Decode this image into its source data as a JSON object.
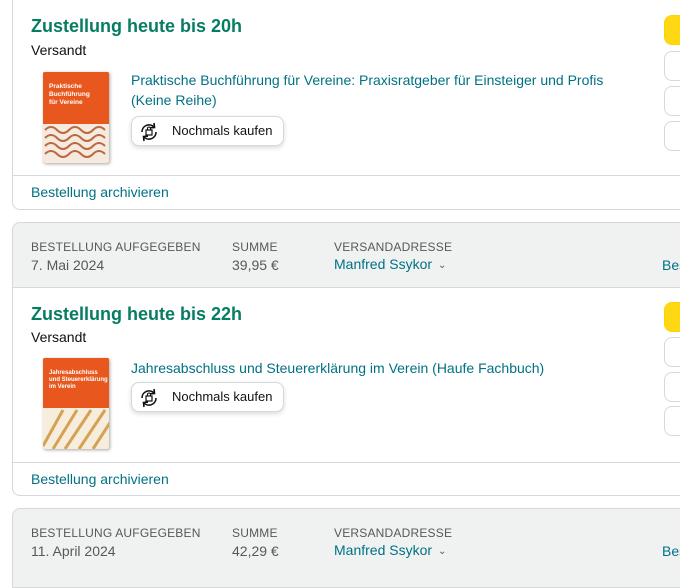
{
  "orders": [
    {
      "delivery_text": "Zustellung heute bis 20h",
      "status_text": "Versandt",
      "item": {
        "title": "Praktische Buchführung für Vereine: Praxisratgeber für Einsteiger und Profis (Keine Reihe)",
        "cover_title": "Praktische Buchführung für Vereine"
      },
      "rebuy_label": "Nochmals kaufen",
      "archive_label": "Bestellung archivieren"
    },
    {
      "delivery_text": "Zustellung heute bis 22h",
      "status_text": "Versandt",
      "item": {
        "title": "Jahresabschluss und Steuererklärung im Verein (Haufe Fachbuch)",
        "cover_title": "Jahresabschluss und Steuererklärung im Verein"
      },
      "rebuy_label": "Nochmals kaufen",
      "archive_label": "Bestellung archivieren"
    }
  ],
  "order_headers": [
    {
      "placed_label": "BESTELLUNG AUFGEGEBEN",
      "placed_date": "7. Mai 2024",
      "total_label": "SUMME",
      "total_value": "39,95 €",
      "address_label": "VERSANDADRESSE",
      "address_name": "Manfred Ssykor",
      "right_link_partial": "Bes"
    },
    {
      "placed_label": "BESTELLUNG AUFGEGEBEN",
      "placed_date": "11. April 2024",
      "total_label": "SUMME",
      "total_value": "42,29 €",
      "address_label": "VERSANDADRESSE",
      "address_name": "Manfred Ssykor",
      "right_link_partial": "Bes"
    }
  ],
  "colors": {
    "delivery_green": "#067d62",
    "link_teal": "#007185",
    "primary_button": "#ffd814",
    "header_bg": "#f0f2f2",
    "cover_orange": "#e8571e"
  },
  "icons": {
    "rebuy": "rebuy-icon",
    "chevron": "chevron-down-icon"
  }
}
